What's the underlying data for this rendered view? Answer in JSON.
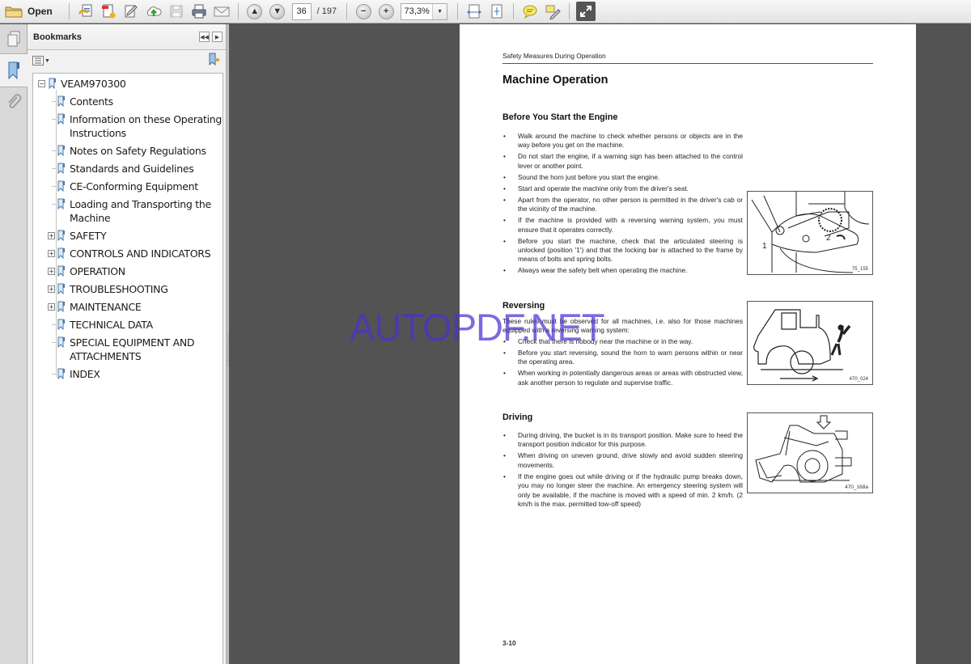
{
  "toolbar": {
    "open_label": "Open",
    "icons": [
      "open-folder-icon",
      "create-pdf-icon",
      "export-pdf-icon",
      "edit-pdf-icon",
      "upload-cloud-icon",
      "save-icon",
      "print-icon",
      "email-icon"
    ],
    "current_page": "36",
    "total_pages": "/ 197",
    "zoom_value": "73,3%"
  },
  "rail": {
    "tabs": [
      "page-thumbnails",
      "bookmarks",
      "attachments"
    ]
  },
  "bookmarks": {
    "title": "Bookmarks",
    "root": "VEAM970300",
    "items": [
      {
        "label": "Contents",
        "expandable": false
      },
      {
        "label": "Information on these Operating Instructions",
        "expandable": false
      },
      {
        "label": "Notes on Safety Regulations",
        "expandable": false
      },
      {
        "label": "Standards and Guidelines",
        "expandable": false
      },
      {
        "label": "CE-Conforming Equipment",
        "expandable": false
      },
      {
        "label": "Loading and Transporting the Machine",
        "expandable": false
      },
      {
        "label": "SAFETY",
        "expandable": true
      },
      {
        "label": "CONTROLS AND INDICATORS",
        "expandable": true
      },
      {
        "label": "OPERATION",
        "expandable": true
      },
      {
        "label": "TROUBLESHOOTING",
        "expandable": true
      },
      {
        "label": "MAINTENANCE",
        "expandable": true
      },
      {
        "label": "TECHNICAL DATA",
        "expandable": false
      },
      {
        "label": "SPECIAL EQUIPMENT AND ATTACHMENTS",
        "expandable": false
      },
      {
        "label": "INDEX",
        "expandable": false
      }
    ]
  },
  "document": {
    "running_head": "Safety Measures During Operation",
    "title": "Machine Operation",
    "sections": [
      {
        "heading": "Before You Start the Engine",
        "intro": "",
        "bullets": [
          "Walk around the machine to check whether persons or objects are in the way before you get on the machine.",
          "Do not start the engine, if a warning sign has been attached to the control lever or another point.",
          "Sound the horn just before you start the engine.",
          "Start and operate the machine only from the driver's seat.",
          "Apart from the operator, no other person is permitted in the driver's cab or the vicinity of the machine.",
          "If the machine is provided with a reversing warning system, you must ensure that it operates correctly.",
          "Before you start the machine, check that the articulated steering is unlocked (position '1') and that the locking bar is attached to the frame by means of bolts and spring bolts.",
          "Always wear the safety belt when operating the machine."
        ],
        "figure_label": "75_155"
      },
      {
        "heading": "Reversing",
        "intro": "These rules must be observed for all machines, i.e. also for those machines equipped with a reversing warning system:",
        "bullets": [
          "Check that there is nobody near the machine or in the way.",
          "Before you start reversing, sound the horn to warn persons within or near the operating area.",
          "When working in potentially dangerous areas or areas with obstructed view, ask another person to regulate and supervise traffic."
        ],
        "figure_label": "470_024"
      },
      {
        "heading": "Driving",
        "intro": "",
        "bullets": [
          "During driving, the bucket is in its transport position. Make sure to heed the transport position indicator for this purpose.",
          "When driving on uneven ground, drive slowly and avoid sudden steering movements.",
          "If the engine goes out while driving or if the hydraulic pump breaks down, you may no longer steer the machine. An emergency steering system will only be available, if the machine is moved with a speed of min. 2 km/h. (2 km/h is the max. permitted tow-off speed)"
        ],
        "figure_label": "470_168a"
      }
    ],
    "figure1_callouts": [
      "1",
      "2"
    ],
    "page_number": "3-10"
  },
  "watermark": "AUTOPDF.NET"
}
